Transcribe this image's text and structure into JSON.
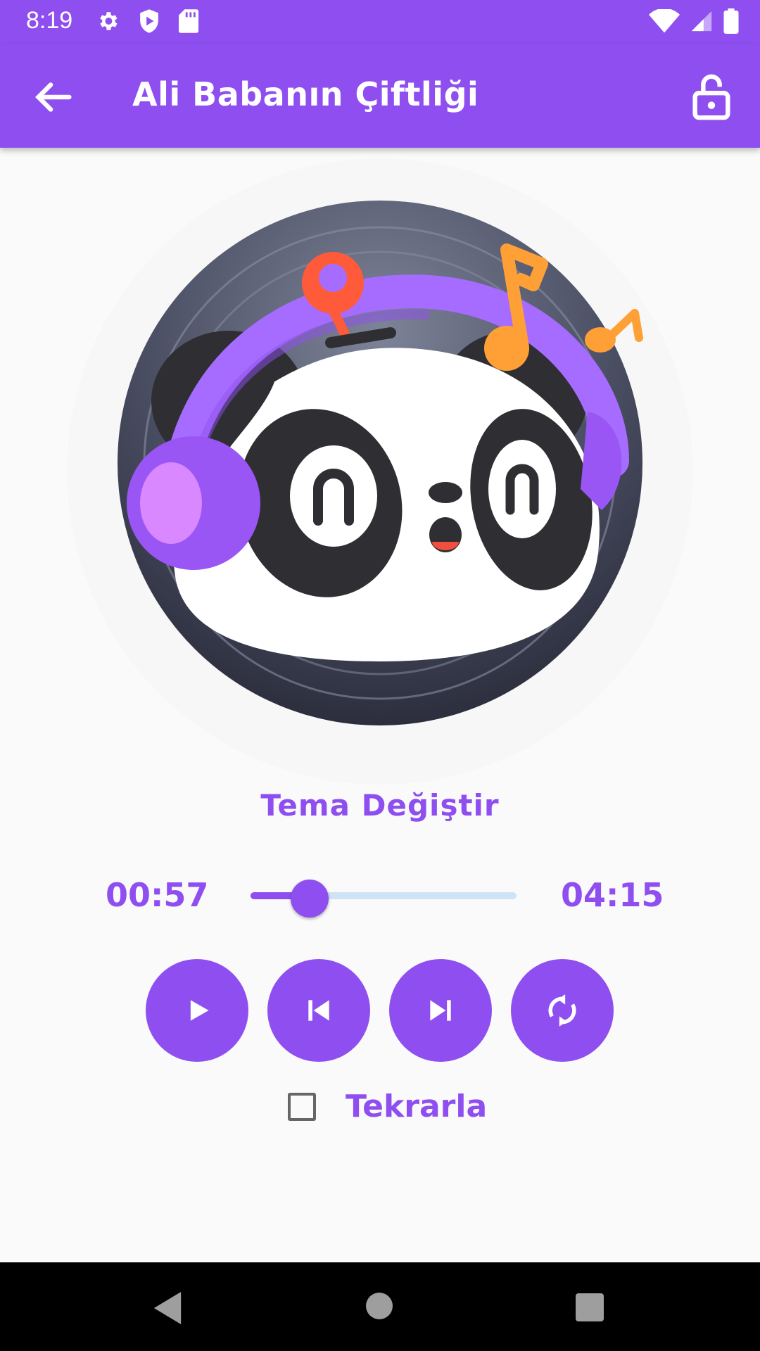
{
  "status_bar": {
    "time": "8:19",
    "icons": [
      "settings-icon",
      "shield-play-icon",
      "sd-card-icon",
      "wifi-icon",
      "signal-icon",
      "battery-icon"
    ]
  },
  "app_bar": {
    "title": "Ali Babanın Çiftliği",
    "back_icon": "arrow-back-icon",
    "lock_icon": "lock-open-icon"
  },
  "theme": {
    "label": "Tema Değiştir"
  },
  "player": {
    "elapsed": "00:57",
    "total": "04:15",
    "progress": 0.2235
  },
  "controls": [
    {
      "name": "play-button",
      "icon": "play-icon"
    },
    {
      "name": "previous-button",
      "icon": "skip-previous-icon"
    },
    {
      "name": "next-button",
      "icon": "skip-next-icon"
    },
    {
      "name": "shuffle-button",
      "icon": "refresh-icon"
    }
  ],
  "repeat": {
    "label": "Tekrarla",
    "checked": false
  },
  "colors": {
    "accent": "#8f4ff0",
    "track": "#cfe3f7",
    "nav": "#000000"
  }
}
